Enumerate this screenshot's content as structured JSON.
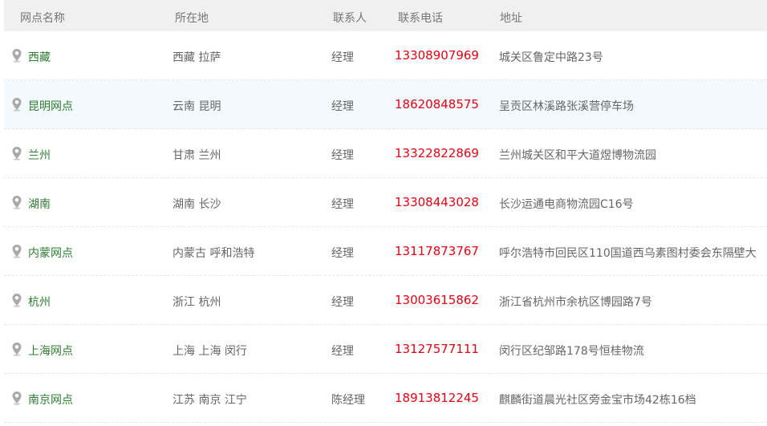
{
  "header": {
    "name": "网点名称",
    "location": "所在地",
    "contact": "联系人",
    "phone": "联系电话",
    "address": "地址"
  },
  "rows": [
    {
      "name": "西藏",
      "location": "西藏 拉萨",
      "contact": "经理",
      "phone": "13308907969",
      "address": "城关区鲁定中路23号"
    },
    {
      "name": "昆明网点",
      "location": "云南 昆明",
      "contact": "经理",
      "phone": "18620848575",
      "address": "呈贡区林溪路张溪营停车场"
    },
    {
      "name": "兰州",
      "location": "甘肃 兰州",
      "contact": "经理",
      "phone": "13322822869",
      "address": "兰州城关区和平大道煜博物流园"
    },
    {
      "name": "湖南",
      "location": "湖南 长沙",
      "contact": "经理",
      "phone": "13308443028",
      "address": "长沙运通电商物流园C16号"
    },
    {
      "name": "内蒙网点",
      "location": "内蒙古 呼和浩特",
      "contact": "经理",
      "phone": "13117873767",
      "address": "呼尔浩特市回民区110国道西乌素图村委会东隔壁大"
    },
    {
      "name": "杭州",
      "location": "浙江 杭州",
      "contact": "经理",
      "phone": "13003615862",
      "address": "浙江省杭州市余杭区博园路7号"
    },
    {
      "name": "上海网点",
      "location": "上海 上海 闵行",
      "contact": "经理",
      "phone": "13127577111",
      "address": "闵行区纪邹路178号恒桂物流"
    },
    {
      "name": "南京网点",
      "location": "江苏 南京 江宁",
      "contact": "陈经理",
      "phone": "18913812245",
      "address": "麒麟街道晨光社区旁金宝市场42栋16档"
    }
  ],
  "colors": {
    "name_link": "#2e7d32",
    "phone": "#e60012",
    "header_bg": "#f0f0f0",
    "highlight_row_bg": "#f3f9fd"
  },
  "icons": {
    "row_marker": "map-pin-icon"
  }
}
